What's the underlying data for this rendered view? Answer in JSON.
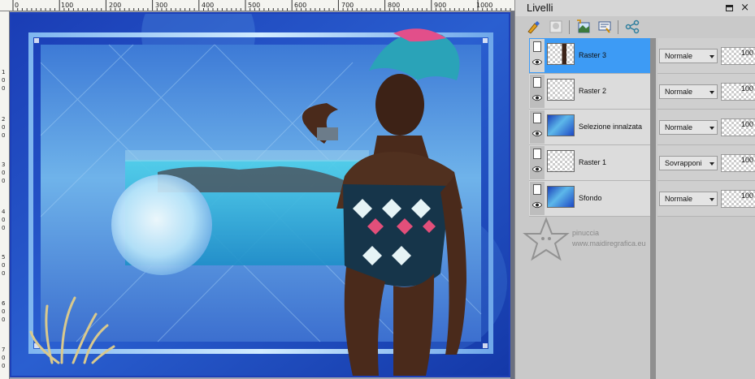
{
  "ruler": {
    "top_labels": [
      "0",
      "100",
      "200",
      "300",
      "400",
      "500",
      "600",
      "700",
      "800",
      "900",
      "1000"
    ],
    "left_digits": [
      "1",
      "0",
      "0",
      "2",
      "0",
      "0",
      "3",
      "0",
      "0",
      "4",
      "0",
      "0",
      "5",
      "0",
      "0",
      "6",
      "0",
      "0",
      "7",
      "0",
      "0"
    ]
  },
  "panel": {
    "title": "Livelli",
    "toolbar_icons": [
      "paint-brush-icon",
      "mask-icon",
      "new-layer-icon",
      "properties-icon",
      "link-icon"
    ]
  },
  "layers": [
    {
      "name": "Raster 3",
      "thumb": "woman",
      "selected": true,
      "blend": "Normale",
      "opacity": "100"
    },
    {
      "name": "Raster 2",
      "thumb": "transparent",
      "selected": false,
      "blend": "Normale",
      "opacity": "100"
    },
    {
      "name": "Selezione innalzata",
      "thumb": "blue",
      "selected": false,
      "blend": "Normale",
      "opacity": "100"
    },
    {
      "name": "Raster 1",
      "thumb": "transparent",
      "selected": false,
      "blend": "Sovrapponi",
      "opacity": "100"
    },
    {
      "name": "Sfondo",
      "thumb": "blue",
      "selected": false,
      "blend": "Normale",
      "opacity": "100"
    }
  ],
  "watermark": {
    "brand": "pinuccia",
    "url": "www.maidiregrafica.eu"
  },
  "colors": {
    "canvas_blue": "#1b40b8",
    "selection_blue": "#3d9bf5",
    "panel_gray": "#c9c9c9"
  }
}
